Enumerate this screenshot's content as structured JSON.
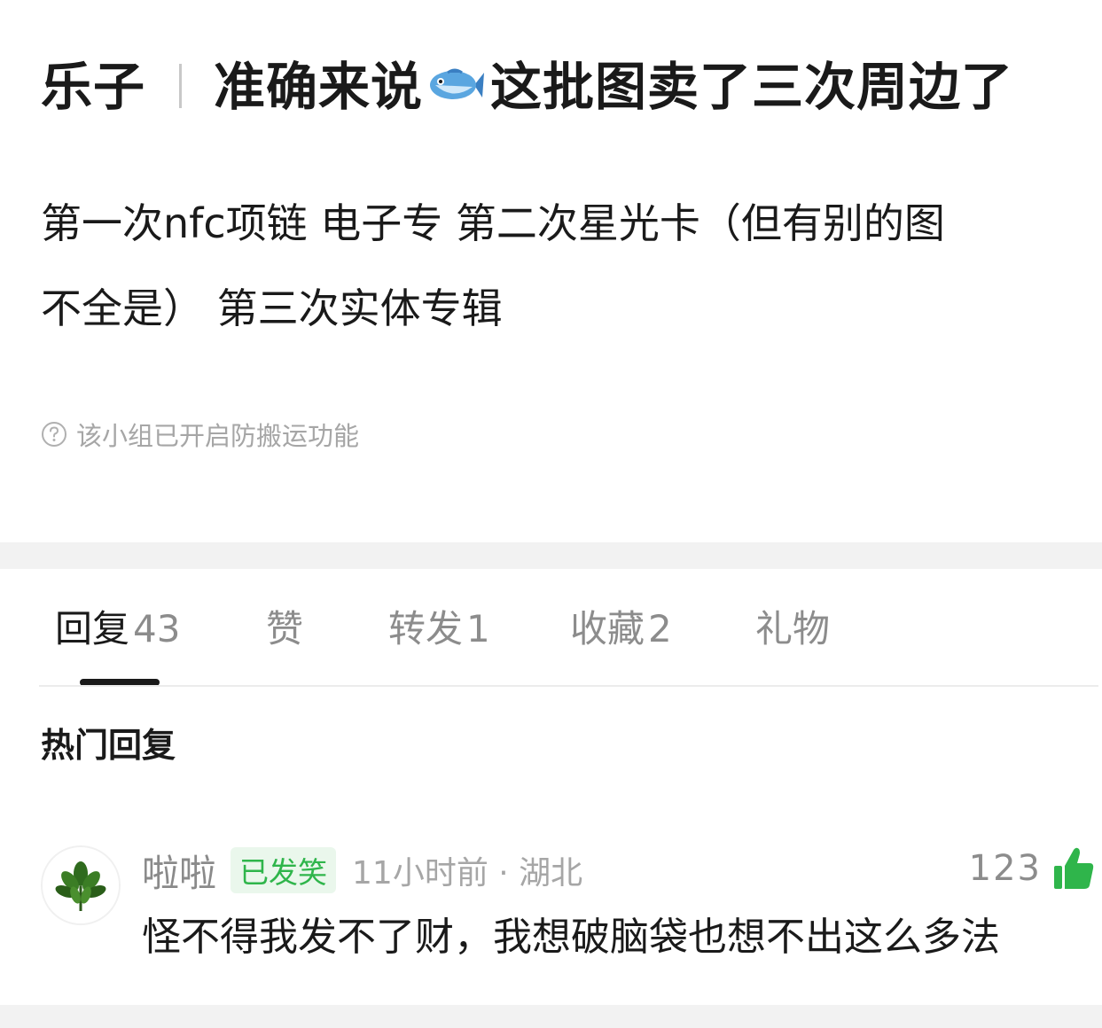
{
  "post": {
    "group": "乐子",
    "title_part1": "准确来说",
    "title_emoji": "fish-emoji",
    "title_part2": "这批图卖了三次周边了",
    "body_line1": "第一次nfc项链 电子专 第二次星光卡（但有别的图",
    "body_line2": "不全是） 第三次实体专辑",
    "notice": "该小组已开启防搬运功能"
  },
  "tabs": [
    {
      "label": "回复",
      "count": "43",
      "active": true
    },
    {
      "label": "赞",
      "count": ""
    },
    {
      "label": "转发",
      "count": "1"
    },
    {
      "label": "收藏",
      "count": "2"
    },
    {
      "label": "礼物",
      "count": ""
    }
  ],
  "section": {
    "hot_replies": "热门回复"
  },
  "comment": {
    "user": "啦啦",
    "badge": "已发笑",
    "time_location": "11小时前 · 湖北",
    "likes": "123",
    "text": "怪不得我发不了财，我想破脑袋也想不出这么多法",
    "avatar": "leaf-avatar"
  },
  "colors": {
    "text_primary": "#1a1a1a",
    "text_secondary": "#8c8c8c",
    "accent_green": "#2fb54b",
    "badge_bg": "#eaf7ec",
    "band_gray": "#f2f2f2"
  }
}
